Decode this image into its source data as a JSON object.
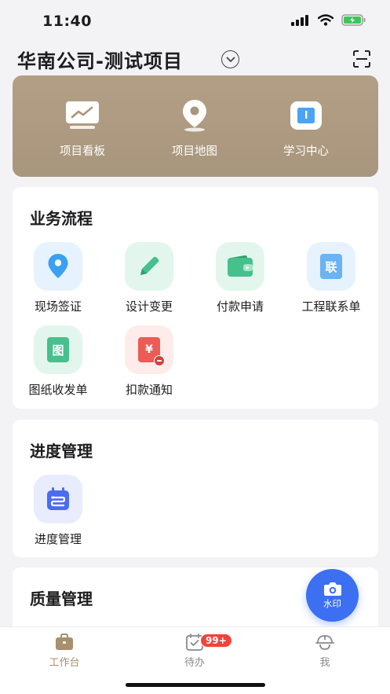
{
  "status_bar": {
    "time": "11:40"
  },
  "header": {
    "title": "华南公司-测试项目"
  },
  "banner": {
    "items": [
      {
        "label": "项目看板",
        "icon": "chart-board-icon"
      },
      {
        "label": "项目地图",
        "icon": "map-pin-icon"
      },
      {
        "label": "学习中心",
        "icon": "book-icon"
      }
    ]
  },
  "business": {
    "title": "业务流程",
    "items": [
      {
        "label": "现场签证",
        "icon": "location-pin-icon"
      },
      {
        "label": "设计变更",
        "icon": "pencil-icon"
      },
      {
        "label": "付款申请",
        "icon": "wallet-icon"
      },
      {
        "label": "工程联系单",
        "icon": "contact-sheet-icon",
        "glyph": "联"
      },
      {
        "label": "图纸收发单",
        "icon": "drawing-doc-icon",
        "glyph": "图"
      },
      {
        "label": "扣款通知",
        "icon": "deduction-doc-icon",
        "glyph": "¥"
      }
    ]
  },
  "progress": {
    "title": "进度管理",
    "items": [
      {
        "label": "进度管理",
        "icon": "calendar-progress-icon"
      }
    ]
  },
  "quality": {
    "title": "质量管理"
  },
  "fab": {
    "label": "水印",
    "icon": "camera-icon"
  },
  "tabbar": {
    "items": [
      {
        "label": "工作台",
        "icon": "briefcase-icon",
        "active": true
      },
      {
        "label": "待办",
        "icon": "todo-icon",
        "badge": "99+"
      },
      {
        "label": "我",
        "icon": "helmet-icon"
      }
    ]
  },
  "colors": {
    "accent": "#3c6ff2",
    "banner": "#ad9a81",
    "tab_active": "#a88f6e",
    "badge": "#f0443a"
  }
}
